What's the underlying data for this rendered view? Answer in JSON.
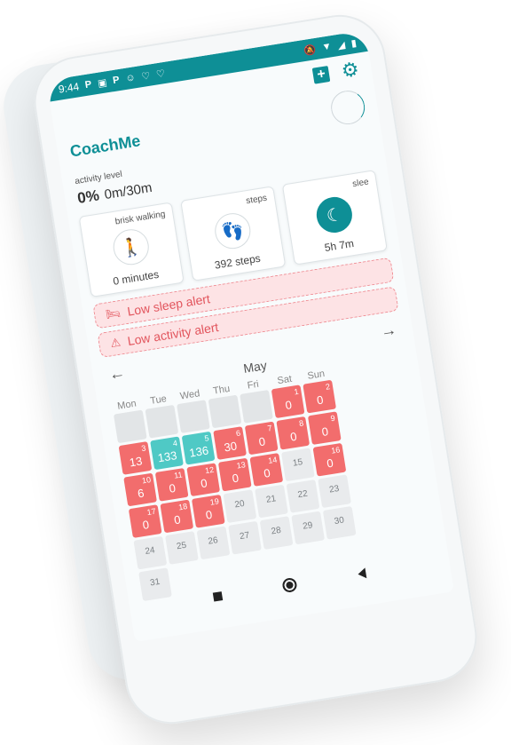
{
  "status_bar": {
    "time": "9:44",
    "left_icons": [
      "P",
      "▣",
      "P",
      "☺",
      "♡",
      "♡"
    ]
  },
  "app": {
    "brand": "CoachMe"
  },
  "activity": {
    "label": "activity level",
    "percent": "0%",
    "value": "0m/30m"
  },
  "cards": [
    {
      "title": "brisk walking",
      "value": "0 minutes",
      "icon": "walking-icon"
    },
    {
      "title": "steps",
      "value": "392 steps",
      "icon": "footsteps-icon"
    },
    {
      "title": "slee",
      "value": "5h 7m",
      "icon": "moon-icon"
    }
  ],
  "alerts": [
    {
      "text": "Low sleep alert",
      "icon": "bed-icon"
    },
    {
      "text": "Low activity alert",
      "icon": "warning-icon"
    }
  ],
  "calendar": {
    "month": "May",
    "weekdays": [
      "Mon",
      "Tue",
      "Wed",
      "Thu",
      "Fri",
      "Sat",
      "Sun"
    ],
    "days": [
      {
        "d": "",
        "v": "",
        "s": "empty"
      },
      {
        "d": "",
        "v": "",
        "s": "empty"
      },
      {
        "d": "",
        "v": "",
        "s": "empty"
      },
      {
        "d": "",
        "v": "",
        "s": "empty"
      },
      {
        "d": "",
        "v": "",
        "s": "empty"
      },
      {
        "d": "1",
        "v": "0",
        "s": "red"
      },
      {
        "d": "2",
        "v": "0",
        "s": "red"
      },
      {
        "d": "3",
        "v": "13",
        "s": "red"
      },
      {
        "d": "4",
        "v": "133",
        "s": "teal"
      },
      {
        "d": "5",
        "v": "136",
        "s": "teal"
      },
      {
        "d": "6",
        "v": "30",
        "s": "red"
      },
      {
        "d": "7",
        "v": "0",
        "s": "red"
      },
      {
        "d": "8",
        "v": "0",
        "s": "red"
      },
      {
        "d": "9",
        "v": "0",
        "s": "red"
      },
      {
        "d": "10",
        "v": "6",
        "s": "red"
      },
      {
        "d": "11",
        "v": "0",
        "s": "red"
      },
      {
        "d": "12",
        "v": "0",
        "s": "red"
      },
      {
        "d": "13",
        "v": "0",
        "s": "red"
      },
      {
        "d": "14",
        "v": "0",
        "s": "red"
      },
      {
        "d": "15",
        "v": "",
        "s": "future"
      },
      {
        "d": "16",
        "v": "0",
        "s": "red"
      },
      {
        "d": "17",
        "v": "0",
        "s": "red"
      },
      {
        "d": "18",
        "v": "0",
        "s": "red"
      },
      {
        "d": "19",
        "v": "0",
        "s": "red"
      },
      {
        "d": "20",
        "v": "",
        "s": "future"
      },
      {
        "d": "21",
        "v": "",
        "s": "future"
      },
      {
        "d": "22",
        "v": "",
        "s": "future"
      },
      {
        "d": "23",
        "v": "",
        "s": "future"
      },
      {
        "d": "24",
        "v": "",
        "s": "future"
      },
      {
        "d": "25",
        "v": "",
        "s": "future"
      },
      {
        "d": "26",
        "v": "",
        "s": "future"
      },
      {
        "d": "27",
        "v": "",
        "s": "future"
      },
      {
        "d": "28",
        "v": "",
        "s": "future"
      },
      {
        "d": "29",
        "v": "",
        "s": "future"
      },
      {
        "d": "30",
        "v": "",
        "s": "future"
      },
      {
        "d": "31",
        "v": "",
        "s": "future"
      }
    ]
  },
  "colors": {
    "accent": "#0e8f96",
    "red": "#f26d6d",
    "teal": "#4fc9c5",
    "alert_bg": "#fde3e5"
  }
}
